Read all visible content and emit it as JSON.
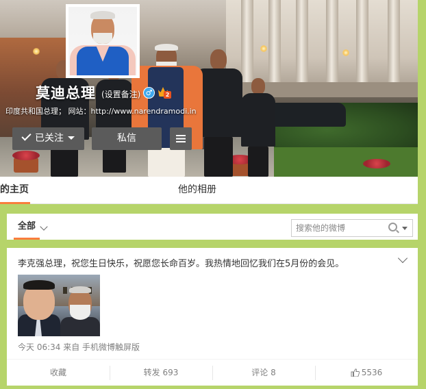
{
  "profile": {
    "name": "莫迪总理",
    "remark": "(设置备注)",
    "gender_symbol": "♂",
    "vip_level": "2",
    "bio": "印度共和国总理； 网站：http://www.narendramodi.in",
    "follow_label": "已关注",
    "message_label": "私信"
  },
  "tabs": {
    "home": "的主页",
    "album": "他的相册"
  },
  "filter": {
    "all_label": "全部",
    "search_placeholder": "搜索他的微博"
  },
  "post": {
    "text": "李克强总理，祝您生日快乐，祝愿您长命百岁。我热情地回忆我们在5月份的会见。",
    "meta": "今天 06:34 来自 手机微博触屏版",
    "favorite_label": "收藏",
    "forward_label": "转发 693",
    "comment_label": "评论 8",
    "like_count": "5536"
  },
  "colors": {
    "page_background": "#b6d46a",
    "tab_accent": "#fa7d3c",
    "button_grey": "#5a5a5a",
    "meta_text": "#808080"
  },
  "icons": {
    "follow_check": "check-icon",
    "follow_dropdown": "caret-down-icon",
    "more_menu": "hamburger-icon",
    "gender": "male-icon",
    "vip": "crown-icon",
    "search": "search-icon",
    "post_menu": "chevron-down-icon",
    "like": "thumbs-up-icon"
  }
}
